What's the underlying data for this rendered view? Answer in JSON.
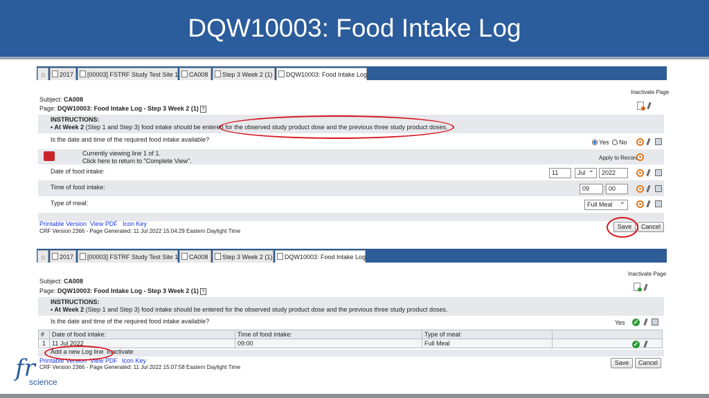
{
  "slide": {
    "title": "DQW10003: Food Intake Log"
  },
  "logo": {
    "mark": "fr",
    "word": "science"
  },
  "top": {
    "tabs": [
      "2017",
      "[00003] FSTRF Study Test Site 1",
      "CA008",
      "Step 3 Week 2 (1)",
      "DQW10003: Food Intake Log"
    ],
    "inactivate": "Inactivate Page",
    "subject_label": "Subject:",
    "subject_value": "CA008",
    "page_label": "Page:",
    "page_value": "DQW10003: Food Intake Log - Step 3 Week 2 (1)",
    "instructions_title": "INSTRUCTIONS:",
    "instr_bold": "• At Week 2",
    "instr_text": " (Step 1 and Step 3) food intake should be entered for the observed study product dose and the previous three study product doses.",
    "question": "Is the date and time of the required food intake available?",
    "yes": "Yes",
    "no": "No",
    "viewing_1": "Currently viewing line 1 of 1.",
    "viewing_2": "Click here to return to \"Complete View\".",
    "apply": "Apply to Record",
    "date_label": "Date of food intake:",
    "day": "11",
    "month": "Jul",
    "year": "2022",
    "time_label": "Time of food intake:",
    "hour": "09",
    "minute": "00",
    "meal_label": "Type of meal:",
    "meal": "Full Meal",
    "link_print": "Printable Version",
    "link_pdf": "View PDF",
    "link_key": "Icon Key",
    "crf": "CRF Version 2366 - Page Generated: 11 Jul 2022 15:04:29 Eastern Daylight Time",
    "save": "Save",
    "cancel": "Cancel"
  },
  "bottom": {
    "tabs": [
      "2017",
      "[00003] FSTRF Study Test Site 1",
      "CA008",
      "Step 3 Week 2 (1)",
      "DQW10003: Food Intake Log"
    ],
    "inactivate": "Inactivate Page",
    "subject_label": "Subject:",
    "subject_value": "CA008",
    "page_label": "Page:",
    "page_value": "DQW10003: Food Intake Log - Step 3 Week 2 (1)",
    "instructions_title": "INSTRUCTIONS:",
    "instr_bold": "• At Week 2",
    "instr_text": " (Step 1 and Step 3) food intake should be entered for the observed study product dose and the previous three study product doses.",
    "question": "Is the date and time of the required food intake available?",
    "answer": "Yes",
    "columns": [
      "#",
      "Date of food intake:",
      "Time of food intake:",
      "Type of meal:"
    ],
    "rows": [
      {
        "num": "1",
        "date": "11 Jul 2022",
        "time": "09:00",
        "meal": "Full Meal"
      }
    ],
    "add_line": "Add a new Log line",
    "inactivate_link": "Inactivate",
    "link_print": "Printable Version",
    "link_pdf": "View PDF",
    "link_key": "Icon Key",
    "crf": "CRF Version 2366 - Page Generated: 11 Jul 2022 15:07:58 Eastern Daylight Time",
    "save": "Save",
    "cancel": "Cancel"
  },
  "colors": {
    "header_blue": "#2b5c9b",
    "tabbar_blue": "#2e5c96",
    "highlight_red": "#d7141b",
    "link_blue": "#1a37d8"
  }
}
